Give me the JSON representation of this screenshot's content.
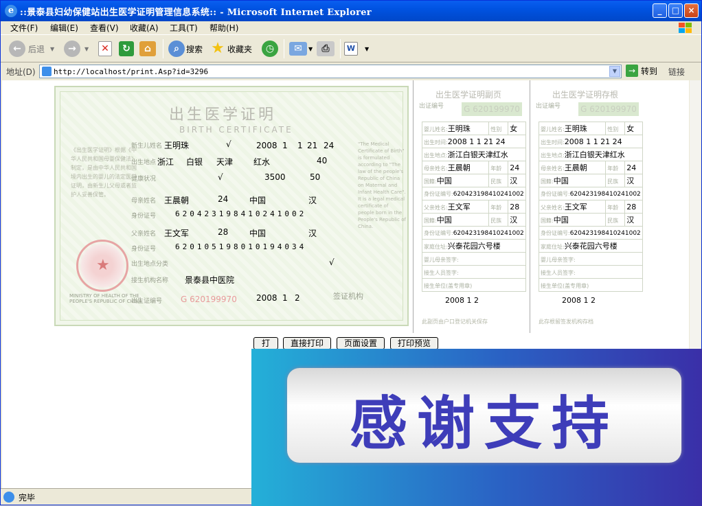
{
  "window": {
    "title": "::景泰县妇幼保健站出生医学证明管理信息系统:: - Microsoft Internet Explorer",
    "buttons": {
      "min": "_",
      "max": "□",
      "close": "×"
    }
  },
  "menu": [
    "文件(F)",
    "编辑(E)",
    "查看(V)",
    "收藏(A)",
    "工具(T)",
    "帮助(H)"
  ],
  "toolbar": {
    "back": "后退",
    "search": "搜索",
    "favorites": "收藏夹"
  },
  "address": {
    "label": "地址(D)",
    "url": "http://localhost/print.Asp?id=3296",
    "go": "转到",
    "links": "链接"
  },
  "certificate": {
    "title": "出生医学证明",
    "subtitle": "BIRTH CERTIFICATE",
    "name": "王明珠",
    "gender_mark": "√",
    "birth_year": "2008",
    "birth_month": "1",
    "birth_day": "1",
    "birth_hour": "21",
    "birth_minute": "24",
    "province": "浙江",
    "city": "白银",
    "county": "天津",
    "township": "红水",
    "gestation": "40",
    "health_mark": "√",
    "weight": "3500",
    "height": "50",
    "mother_name": "王晨朝",
    "mother_age": "24",
    "mother_nationality": "中国",
    "mother_ethnic": "汉",
    "mother_id": "620423198410241002",
    "father_name": "王文军",
    "father_age": "28",
    "father_nationality": "中国",
    "father_ethnic": "汉",
    "father_id": "620105198010194034",
    "place_mark": "√",
    "facility": "景泰县中医院",
    "cert_no": "G 620199970",
    "issue_year": "2008",
    "issue_month": "1",
    "issue_day": "2"
  },
  "stub1": {
    "title": "出生医学证明副页",
    "no_label": "出证编号",
    "no": "G 620199970",
    "name": "王明珠",
    "gender": "女",
    "time": "2008  1   1  21  24",
    "place": "浙江白银天津红水",
    "mother": "王晨朝",
    "mother_age": "24",
    "mother_nat": "中国",
    "mother_eth": "汉",
    "mother_id": "620423198410241002",
    "father": "王文军",
    "father_age": "28",
    "father_nat": "中国",
    "father_eth": "汉",
    "father_id": "620423198410241002",
    "address": "兴泰花园六号楼",
    "date": "2008    1    2",
    "footer": "此副页由户口登记机关保存"
  },
  "stub2": {
    "title": "出生医学证明存根",
    "no_label": "出证编号",
    "no": "G 620199970",
    "name": "王明珠",
    "gender": "女",
    "time": "2008  1   1  21  24",
    "place": "浙江白银天津红水",
    "mother": "王晨朝",
    "mother_age": "24",
    "mother_nat": "中国",
    "mother_eth": "汉",
    "mother_id": "620423198410241002",
    "father": "王文军",
    "father_age": "28",
    "father_nat": "中国",
    "father_eth": "汉",
    "father_id": "620423198410241002",
    "address": "兴泰花园六号楼",
    "date": "2008    1    2",
    "footer": "此存根留签发机构存档"
  },
  "actions": [
    "打印",
    "直接打印",
    "页面设置",
    "打印预览"
  ],
  "thanks": "感谢支持",
  "status": "完毕",
  "colors": {
    "titlebar": "#0053e1",
    "thanks_text": "#3e3db9"
  }
}
